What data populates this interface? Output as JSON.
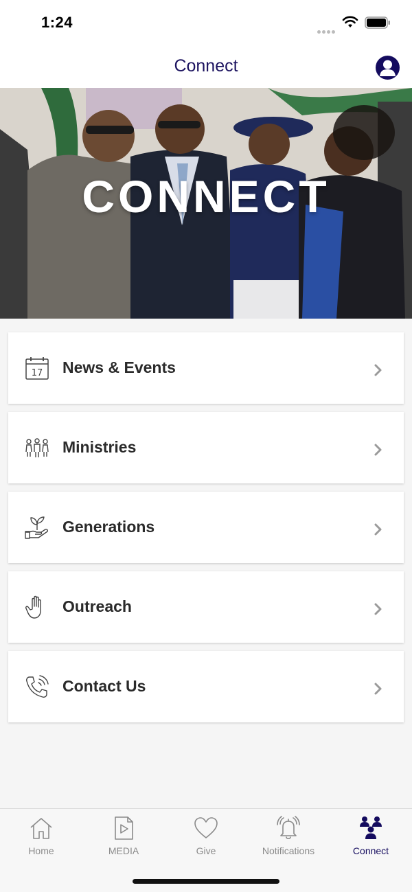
{
  "status_bar": {
    "time": "1:24"
  },
  "nav": {
    "title": "Connect"
  },
  "hero": {
    "text": "CONNECT"
  },
  "menu": {
    "items": [
      {
        "label": "News & Events",
        "icon": "calendar-icon",
        "calendar_day": "17"
      },
      {
        "label": "Ministries",
        "icon": "people-icon"
      },
      {
        "label": "Generations",
        "icon": "plant-hand-icon"
      },
      {
        "label": "Outreach",
        "icon": "hand-icon"
      },
      {
        "label": "Contact Us",
        "icon": "phone-icon"
      }
    ]
  },
  "tabs": [
    {
      "label": "Home",
      "icon": "home-icon",
      "active": false
    },
    {
      "label": "MEDIA",
      "icon": "media-play-icon",
      "active": false
    },
    {
      "label": "Give",
      "icon": "heart-icon",
      "active": false
    },
    {
      "label": "Notifications",
      "icon": "bell-icon",
      "active": false
    },
    {
      "label": "Connect",
      "icon": "group-icon",
      "active": true
    }
  ],
  "colors": {
    "brand": "#140b5e",
    "tab_inactive": "#8a8a8a",
    "background": "#f5f5f5"
  }
}
